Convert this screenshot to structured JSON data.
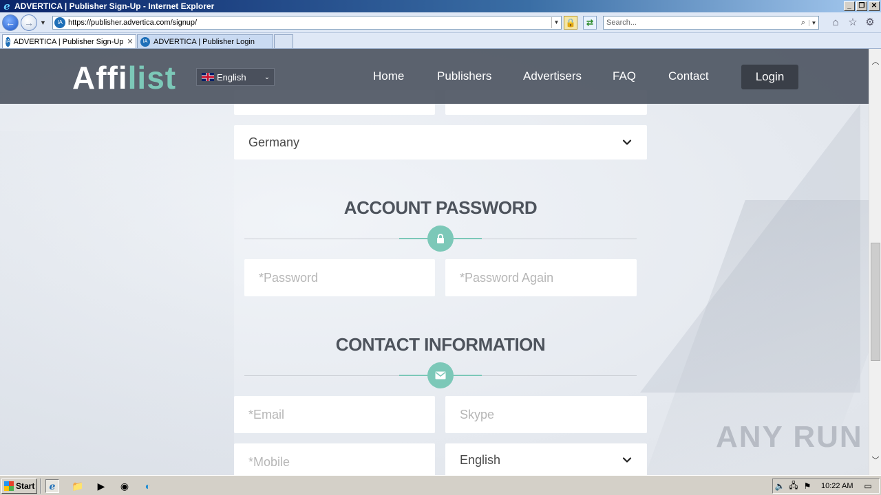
{
  "window": {
    "title": "ADVERTICA | Publisher Sign-Up - Internet Explorer",
    "url": "https://publisher.advertica.com/signup/",
    "search_placeholder": "Search..."
  },
  "tabs": [
    {
      "label": "ADVERTICA | Publisher Sign-Up",
      "active": true
    },
    {
      "label": "ADVERTICA | Publisher Login",
      "active": false
    }
  ],
  "site": {
    "logo_part1": "Affi",
    "logo_part2": "list",
    "language": "English",
    "nav": [
      "Home",
      "Publishers",
      "Advertisers",
      "FAQ",
      "Contact"
    ],
    "login_label": "Login"
  },
  "form": {
    "country_value": "Germany",
    "password_section_title": "ACCOUNT PASSWORD",
    "password_placeholder": "*Password",
    "password_again_placeholder": "*Password Again",
    "contact_section_title": "CONTACT INFORMATION",
    "email_placeholder": "*Email",
    "skype_placeholder": "Skype",
    "mobile_placeholder": "*Mobile",
    "language_value": "English"
  },
  "watermark": "ANY RUN",
  "taskbar": {
    "start_label": "Start",
    "clock": "10:22 AM"
  },
  "colors": {
    "accent": "#7cc8b8",
    "header_bg": "#4e5663",
    "title_text": "#4d535c"
  },
  "icons": {
    "password_badge": "lock-icon",
    "contact_badge": "envelope-icon"
  }
}
